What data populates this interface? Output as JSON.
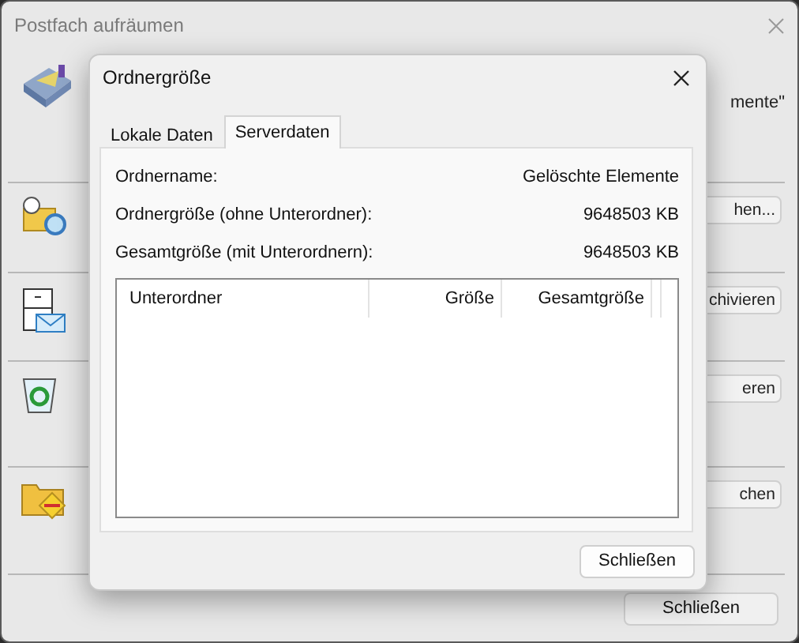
{
  "window": {
    "title": "Postfach aufräumen"
  },
  "sections": [
    {
      "kind": "text",
      "text": "mente\""
    },
    {
      "kind": "button",
      "label": "hen..."
    },
    {
      "kind": "button",
      "label": "chivieren"
    },
    {
      "kind": "button",
      "label": "eren"
    },
    {
      "kind": "button",
      "label": "chen"
    }
  ],
  "close_button": "Schließen",
  "dialog": {
    "title": "Ordnergröße",
    "tabs": [
      {
        "label": "Lokale Daten",
        "selected": false
      },
      {
        "label": "Serverdaten",
        "selected": true
      }
    ],
    "fields": [
      {
        "label": "Ordnername:",
        "value": "Gelöschte Elemente"
      },
      {
        "label": "Ordnergröße (ohne Unterordner):",
        "value": "9648503 KB"
      },
      {
        "label": "Gesamtgröße (mit Unterordnern):",
        "value": "9648503 KB"
      }
    ],
    "table": {
      "columns": [
        "Unterordner",
        "Größe",
        "Gesamtgröße"
      ]
    },
    "button": "Schließen"
  }
}
